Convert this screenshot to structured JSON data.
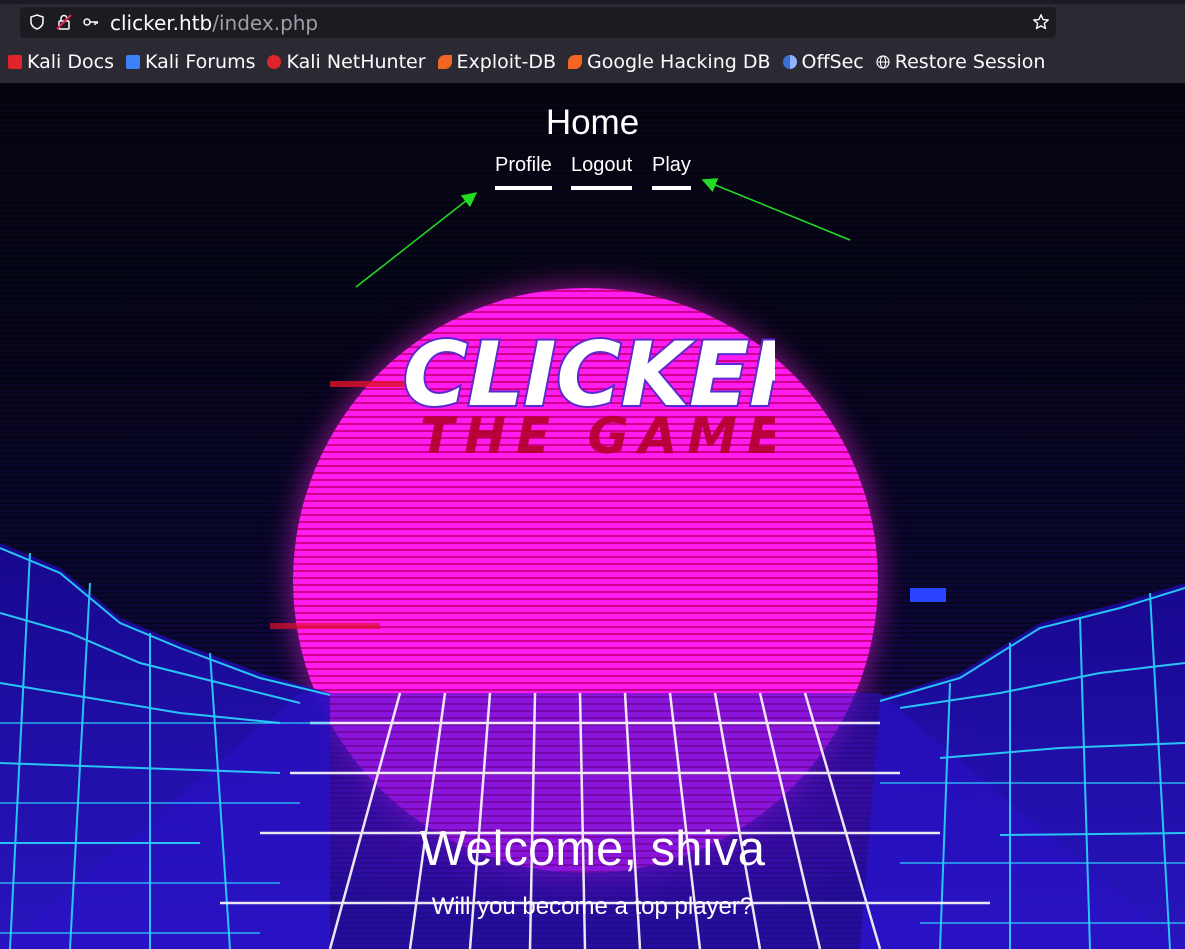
{
  "browser": {
    "url_host": "clicker.htb",
    "url_path": "/index.php",
    "bookmarks": [
      {
        "label": "Kali Docs",
        "icon": "kali-docs-icon",
        "color": "#e0242b"
      },
      {
        "label": "Kali Forums",
        "icon": "kali-forums-icon",
        "color": "#3b82f6"
      },
      {
        "label": "Kali NetHunter",
        "icon": "kali-nethunter-icon",
        "color": "#e0242b"
      },
      {
        "label": "Exploit-DB",
        "icon": "exploit-db-icon",
        "color": "#f26522"
      },
      {
        "label": "Google Hacking DB",
        "icon": "ghdb-icon",
        "color": "#f26522"
      },
      {
        "label": "OffSec",
        "icon": "offsec-icon",
        "color": "#3b6fd6"
      },
      {
        "label": "Restore Session",
        "icon": "globe-icon",
        "color": "#fbfbfe"
      }
    ]
  },
  "nav": {
    "title": "Home",
    "links": [
      {
        "label": "Profile"
      },
      {
        "label": "Logout"
      },
      {
        "label": "Play"
      }
    ]
  },
  "hero": {
    "logo_line1": "CLICKER",
    "logo_line2": "THE GAME",
    "welcome": "Welcome, shiva",
    "tagline": "Will you become a top player?"
  },
  "colors": {
    "arrow": "#22dd22",
    "sun": "#ff1cf0",
    "grid": "#2ad8ff"
  }
}
